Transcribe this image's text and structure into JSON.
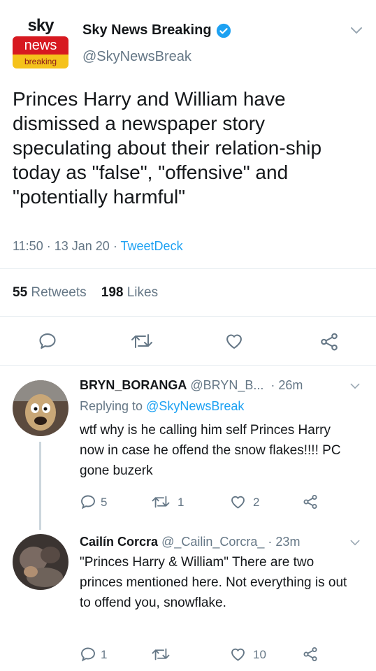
{
  "main_tweet": {
    "logo": {
      "line1": "sky",
      "line2": "news",
      "line3": "breaking"
    },
    "display_name": "Sky News Breaking",
    "handle": "@SkyNewsBreak",
    "text": "Princes Harry and William have dismissed a newspaper story speculating about their relation-ship today as \"false\", \"offensive\" and \"potentially harmful\"",
    "time": "11:50",
    "date": "13 Jan 20",
    "source": "TweetDeck",
    "sep": "·",
    "retweets_count": "55",
    "retweets_label": "Retweets",
    "likes_count": "198",
    "likes_label": "Likes"
  },
  "replies": [
    {
      "display_name": "BRYN_BORANGA",
      "handle": "@BRYN_B...",
      "time": "· 26m",
      "replying_prefix": "Replying to",
      "replying_to": "@SkyNewsBreak",
      "text": "wtf why is he calling him self Princes Harry now in case he offend the snow flakes!!!! PC gone buzerk",
      "reply_count": "5",
      "retweet_count": "1",
      "like_count": "2"
    },
    {
      "display_name": "Cailín Corcra",
      "handle": "@_Cailin_Corcra_",
      "time": "· 23m",
      "text": "\"Princes Harry & William\" There are two princes mentioned here. Not everything is out to offend you, snowflake.",
      "reply_count": "1",
      "retweet_count": "",
      "like_count": "10"
    }
  ],
  "colors": {
    "accent": "#1da1f2",
    "muted": "#657786",
    "icon": "#657786",
    "divider": "#e6ecf0",
    "sky_red": "#d71920",
    "sky_yellow": "#f5c21b"
  }
}
